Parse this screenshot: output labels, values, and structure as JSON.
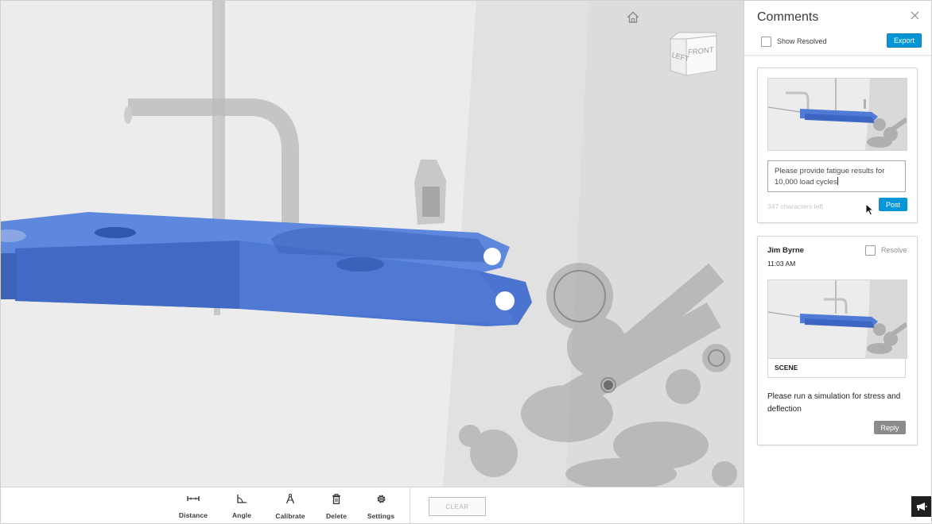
{
  "app": {
    "accent_color": "#0696d7",
    "part_color": "#4b76d0"
  },
  "viewport": {
    "home_icon": "home-icon",
    "viewcube": {
      "left_label": "LEFT",
      "front_label": "FRONT"
    }
  },
  "toolbar": {
    "tools": [
      {
        "label": "Distance",
        "icon": "distance-icon"
      },
      {
        "label": "Angle",
        "icon": "angle-icon"
      },
      {
        "label": "Calibrate",
        "icon": "calibrate-icon"
      },
      {
        "label": "Delete",
        "icon": "trash-icon"
      },
      {
        "label": "Settings",
        "icon": "gear-icon"
      }
    ],
    "clear_label": "CLEAR"
  },
  "comments": {
    "title": "Comments",
    "show_resolved_label": "Show Resolved",
    "export_label": "Export",
    "draft": {
      "text": "Please provide fatigue results for 10,000 load cycles",
      "chars_left": "347 characters left",
      "post_label": "Post"
    },
    "items": [
      {
        "author": "Jim Byrne",
        "time": "11:03 AM",
        "resolve_label": "Resolve",
        "view_label": "SCENE",
        "text": "Please run a simulation for stress and deflection",
        "reply_label": "Reply"
      }
    ]
  }
}
